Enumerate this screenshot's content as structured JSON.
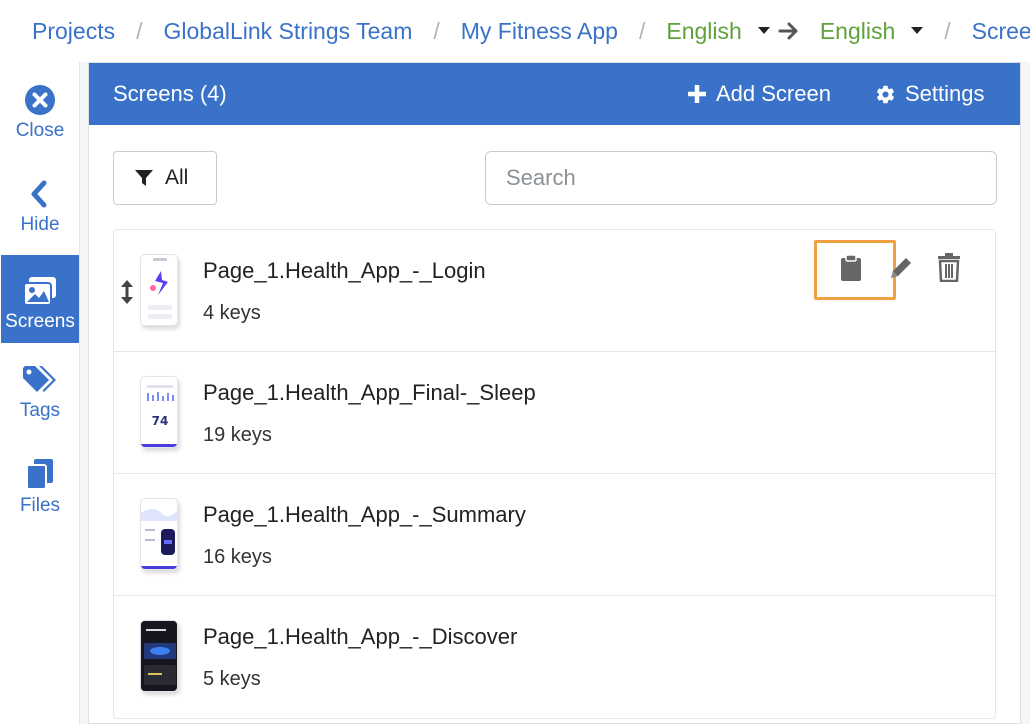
{
  "breadcrumb": {
    "items": [
      "Projects",
      "GlobalLink Strings Team",
      "My Fitness App"
    ],
    "source_language": "English",
    "target_language": "English",
    "current": "Screens"
  },
  "sidebar": {
    "items": [
      {
        "label": "Close",
        "icon": "close-circle-icon"
      },
      {
        "label": "Hide",
        "icon": "chevron-left-icon"
      },
      {
        "label": "Screens",
        "icon": "images-icon",
        "active": true
      },
      {
        "label": "Tags",
        "icon": "tags-icon"
      },
      {
        "label": "Files",
        "icon": "files-icon"
      }
    ]
  },
  "panel": {
    "title": "Screens (4)",
    "add_label": "Add Screen",
    "settings_label": "Settings",
    "filter_label": "All",
    "search_placeholder": "Search"
  },
  "screens": [
    {
      "name": "Page_1.Health_App_-_Login",
      "keys": "4 keys"
    },
    {
      "name": "Page_1.Health_App_Final-_Sleep",
      "keys": "19 keys",
      "thumb_number": "74"
    },
    {
      "name": "Page_1.Health_App_-_Summary",
      "keys": "16 keys"
    },
    {
      "name": "Page_1.Health_App_-_Discover",
      "keys": "5 keys"
    }
  ],
  "row_actions": [
    "clipboard-icon",
    "pencil-icon",
    "trash-icon"
  ],
  "colors": {
    "primary": "#3a72c9",
    "language": "#5ea33a",
    "highlight": "#f0a143",
    "icon_gray": "#666666"
  }
}
